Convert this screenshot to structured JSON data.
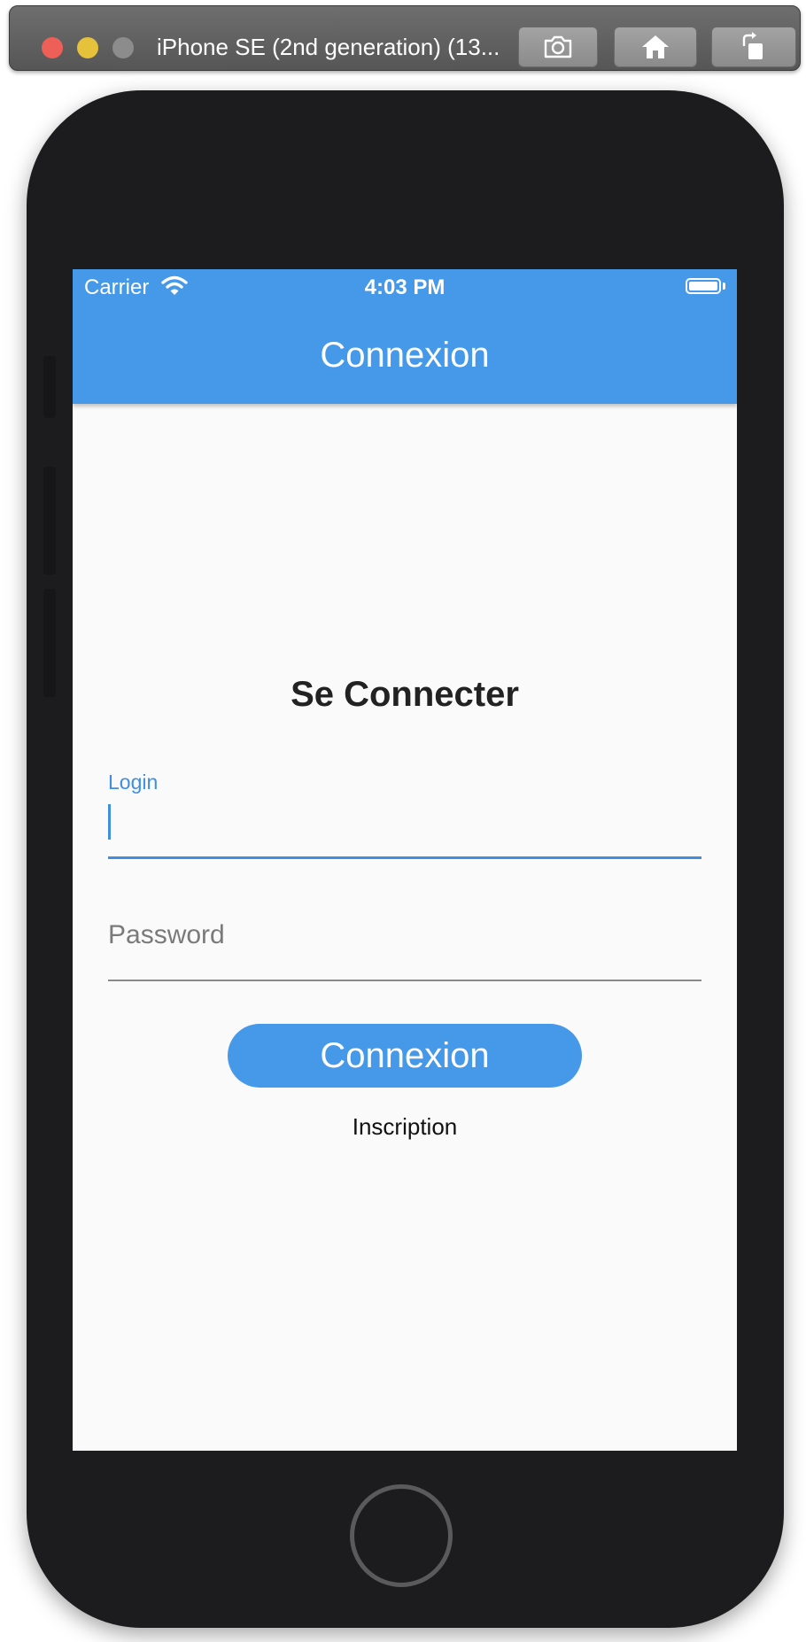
{
  "simulator": {
    "title": "iPhone SE (2nd generation) (13...",
    "screenshot_icon": "camera-icon",
    "home_icon": "house-icon",
    "rotate_icon": "rotate-icon"
  },
  "status_bar": {
    "carrier": "Carrier",
    "time": "4:03 PM",
    "wifi_icon": "wifi-icon",
    "battery_icon": "battery-full-icon"
  },
  "app_bar": {
    "title": "Connexion"
  },
  "form": {
    "heading": "Se Connecter",
    "login_label": "Login",
    "login_value": "",
    "password_placeholder": "Password",
    "password_value": "",
    "submit_label": "Connexion",
    "signup_label": "Inscription"
  },
  "colors": {
    "primary": "#4698e9",
    "focus": "#3f8ee3",
    "background": "#fafafa",
    "device": "#1c1c1e"
  }
}
